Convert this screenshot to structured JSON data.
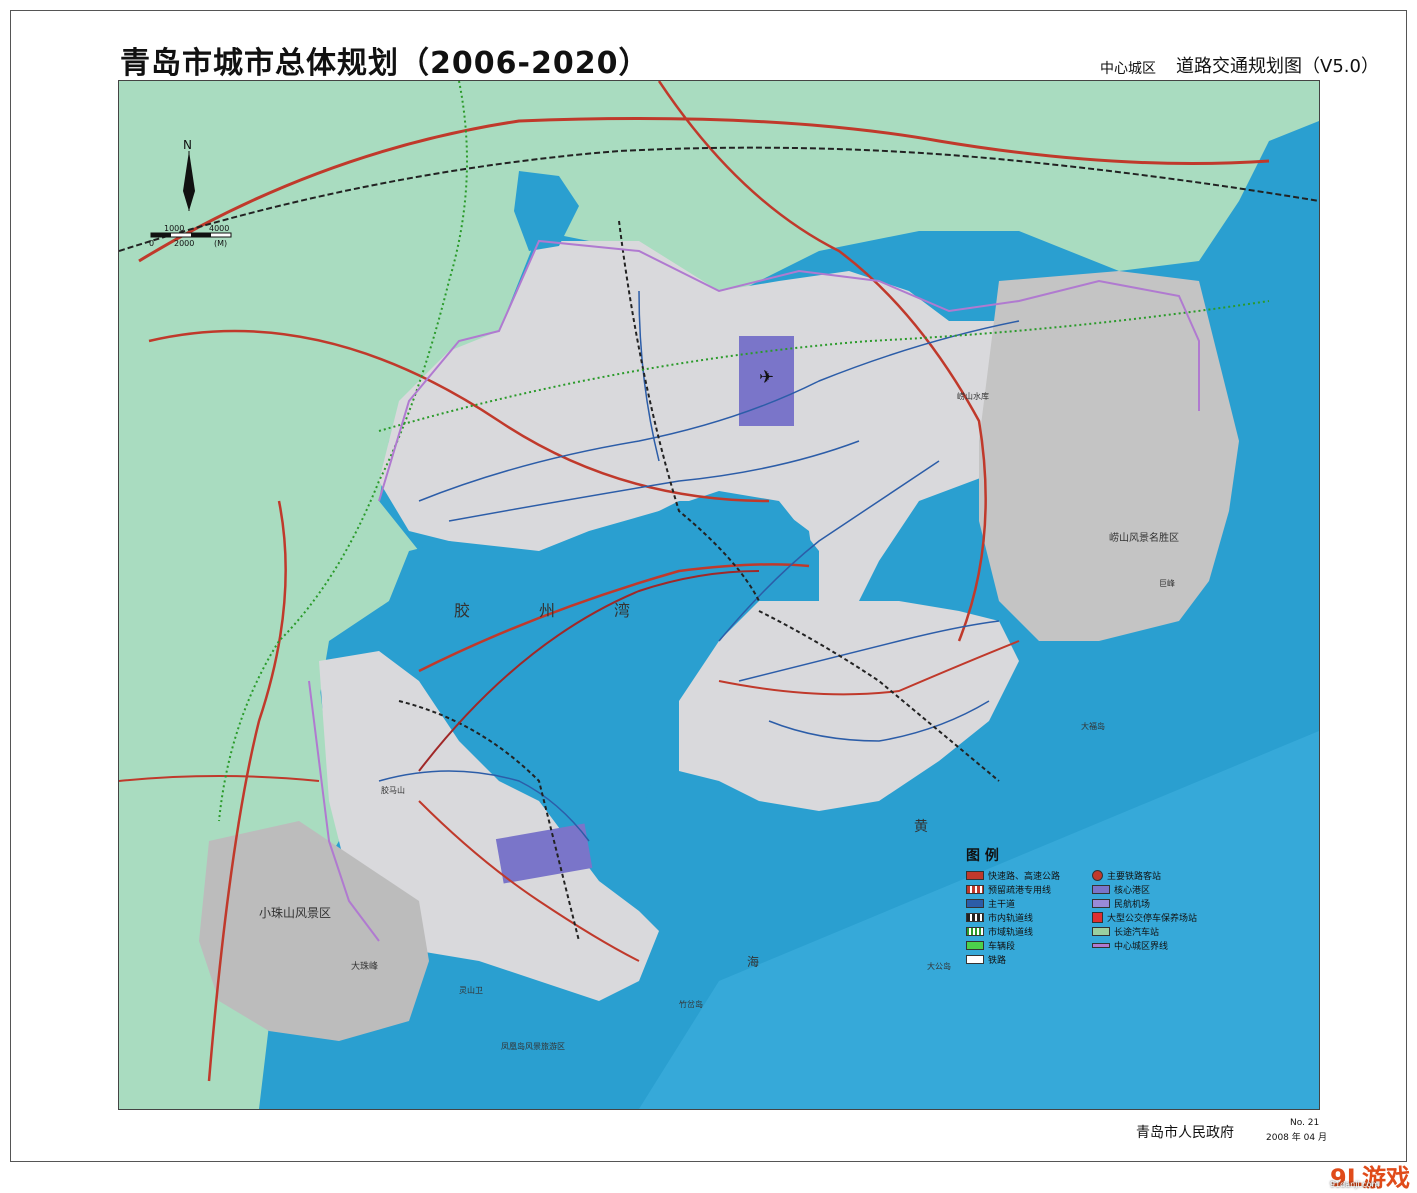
{
  "title": {
    "main": "青岛市城市总体规划（2006-2020）",
    "sub_left": "中心城区",
    "sub_right": "道路交通规划图（V5.0）"
  },
  "compass": {
    "north": "N",
    "scale_top_a": "1000",
    "scale_top_b": "4000",
    "scale_bottom_a": "0",
    "scale_bottom_b": "2000",
    "scale_unit": "(M)"
  },
  "map_labels": {
    "jiaozhou_bay_a": "胶",
    "jiaozhou_bay_b": "州",
    "jiaozhou_bay_c": "湾",
    "yellow_sea_a": "黄",
    "yellow_sea_b": "海",
    "laoshan": "崂山风景名胜区",
    "xiaozhushan": "小珠山风景区",
    "dazhufeng": "大珠峰",
    "fenghuangdao": "凤凰岛风景旅游区",
    "lingshanwei": "灵山卫",
    "dagongdao": "大公岛",
    "zhugandao": "竹岔岛",
    "dafudao": "大福岛",
    "laoshan_reservoir": "崂山水库",
    "jiaoma": "胶马山",
    "laoshan_peak": "巨峰"
  },
  "legend": {
    "title": "图  例",
    "items_left": [
      "快速路、高速公路",
      "预留疏港专用线",
      "主干道",
      "市内轨道线",
      "市域轨道线",
      "车辆段",
      "铁路"
    ],
    "items_right": [
      "主要铁路客站",
      "核心港区",
      "民航机场",
      "大型公交停车保养场站",
      "长途汽车站",
      "中心城区界线"
    ]
  },
  "colors": {
    "sea": "#2a9fd0",
    "deep_sea": "#1b7fb8",
    "land_outer": "#a9dcc0",
    "urban": "#d9d9dc",
    "mountain": "#bcbcbc",
    "road_red": "#c0392b",
    "road_blue": "#2c5da8",
    "boundary_purple": "#b07ad0",
    "port_purple": "#7a75c9",
    "rail_green": "#2a9a2a"
  },
  "footer": {
    "issuer": "青岛市人民政府",
    "sheet_no": "No. 21",
    "date": "2008 年 04 月"
  },
  "watermark": {
    "logo": "9L游戏",
    "sub": "91danji.com"
  }
}
